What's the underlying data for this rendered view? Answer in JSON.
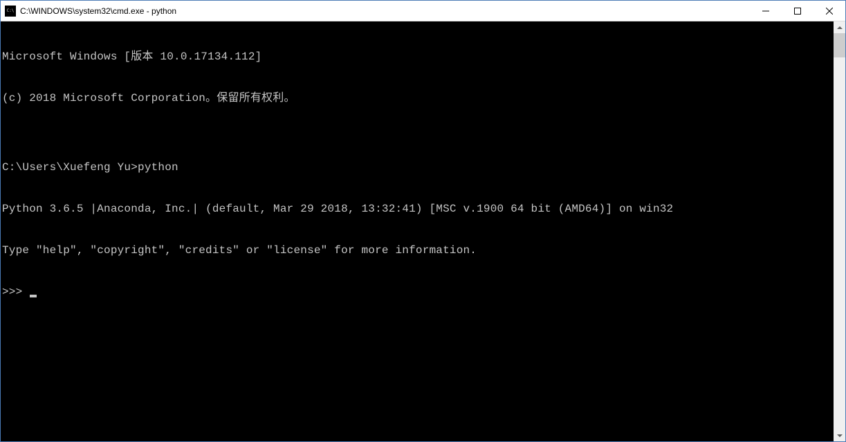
{
  "window": {
    "title": "C:\\WINDOWS\\system32\\cmd.exe - python",
    "icon_label": "C:\\"
  },
  "terminal": {
    "line1": "Microsoft Windows [版本 10.0.17134.112]",
    "line2": "(c) 2018 Microsoft Corporation。保留所有权利。",
    "blank1": "",
    "line3_prompt": "C:\\Users\\Xuefeng Yu>",
    "line3_cmd": "python",
    "line4": "Python 3.6.5 |Anaconda, Inc.| (default, Mar 29 2018, 13:32:41) [MSC v.1900 64 bit (AMD64)] on win32",
    "line5": "Type \"help\", \"copyright\", \"credits\" or \"license\" for more information.",
    "repl_prompt": ">>> "
  }
}
